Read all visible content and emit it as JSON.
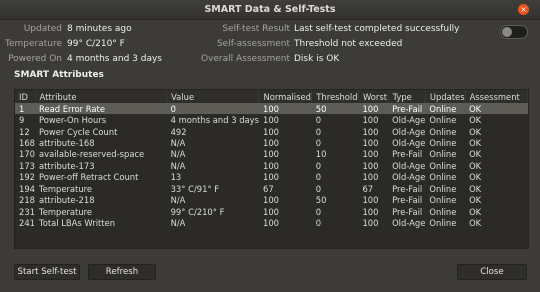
{
  "window": {
    "title": "SMART Data & Self-Tests",
    "close_glyph": "×"
  },
  "info_left": [
    {
      "label": "Updated",
      "value": "8 minutes ago"
    },
    {
      "label": "Temperature",
      "value": "99° C/210° F"
    },
    {
      "label": "Powered On",
      "value": "4 months and 3 days"
    }
  ],
  "info_right": [
    {
      "label": "Self-test Result",
      "value": "Last self-test completed successfully"
    },
    {
      "label": "Self-assessment",
      "value": "Threshold not exceeded"
    },
    {
      "label": "Overall Assessment",
      "value": "Disk is OK"
    }
  ],
  "section_title": "SMART Attributes",
  "table": {
    "columns": [
      "ID",
      "Attribute",
      "Value",
      "Normalised",
      "Threshold",
      "Worst",
      "Type",
      "Updates",
      "Assessment"
    ],
    "rows": [
      [
        "1",
        "Read Error Rate",
        "0",
        "100",
        "50",
        "100",
        "Pre-Fail",
        "Online",
        "OK"
      ],
      [
        "9",
        "Power-On Hours",
        "4 months and 3 days",
        "100",
        "0",
        "100",
        "Old-Age",
        "Online",
        "OK"
      ],
      [
        "12",
        "Power Cycle Count",
        "492",
        "100",
        "0",
        "100",
        "Old-Age",
        "Online",
        "OK"
      ],
      [
        "168",
        "attribute-168",
        "N/A",
        "100",
        "0",
        "100",
        "Old-Age",
        "Online",
        "OK"
      ],
      [
        "170",
        "available-reserved-space",
        "N/A",
        "100",
        "10",
        "100",
        "Pre-Fail",
        "Online",
        "OK"
      ],
      [
        "173",
        "attribute-173",
        "N/A",
        "100",
        "0",
        "100",
        "Old-Age",
        "Online",
        "OK"
      ],
      [
        "192",
        "Power-off Retract Count",
        "13",
        "100",
        "0",
        "100",
        "Old-Age",
        "Online",
        "OK"
      ],
      [
        "194",
        "Temperature",
        "33° C/91° F",
        "67",
        "0",
        "67",
        "Pre-Fail",
        "Online",
        "OK"
      ],
      [
        "218",
        "attribute-218",
        "N/A",
        "100",
        "50",
        "100",
        "Pre-Fail",
        "Online",
        "OK"
      ],
      [
        "231",
        "Temperature",
        "99° C/210° F",
        "100",
        "0",
        "100",
        "Pre-Fail",
        "Online",
        "OK"
      ],
      [
        "241",
        "Total LBAs Written",
        "N/A",
        "100",
        "0",
        "100",
        "Old-Age",
        "Online",
        "OK"
      ]
    ],
    "selected_row": 0
  },
  "buttons": {
    "start": "Start Self-test",
    "refresh": "Refresh",
    "close": "Close"
  }
}
